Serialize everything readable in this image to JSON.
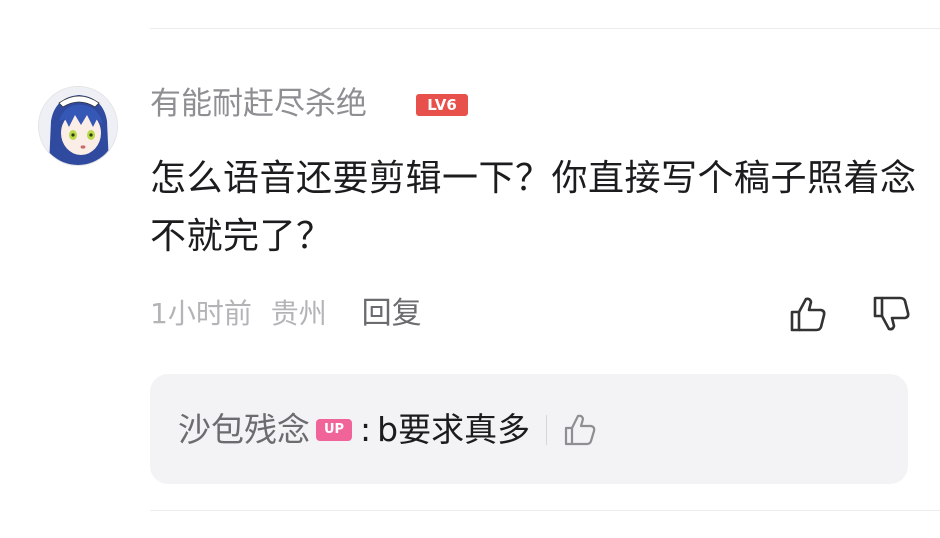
{
  "comment": {
    "username": "有能耐赶尽杀绝",
    "level_badge": "LV6",
    "text": "怎么语音还要剪辑一下？你直接写个稿子照着念不就完了？",
    "time": "1小时前",
    "location": "贵州",
    "reply_label": "回复"
  },
  "sub_reply": {
    "author": "沙包残念",
    "author_badge": "UP",
    "separator": ":",
    "text": "b要求真多"
  },
  "icons": {
    "like": "thumbs-up-icon",
    "dislike": "thumbs-down-icon",
    "reply_like": "thumbs-up-icon"
  },
  "colors": {
    "level_badge": "#e8514b",
    "up_badge": "#f0649a",
    "username": "#8e8e93",
    "reply_box_bg": "#f3f3f5"
  }
}
